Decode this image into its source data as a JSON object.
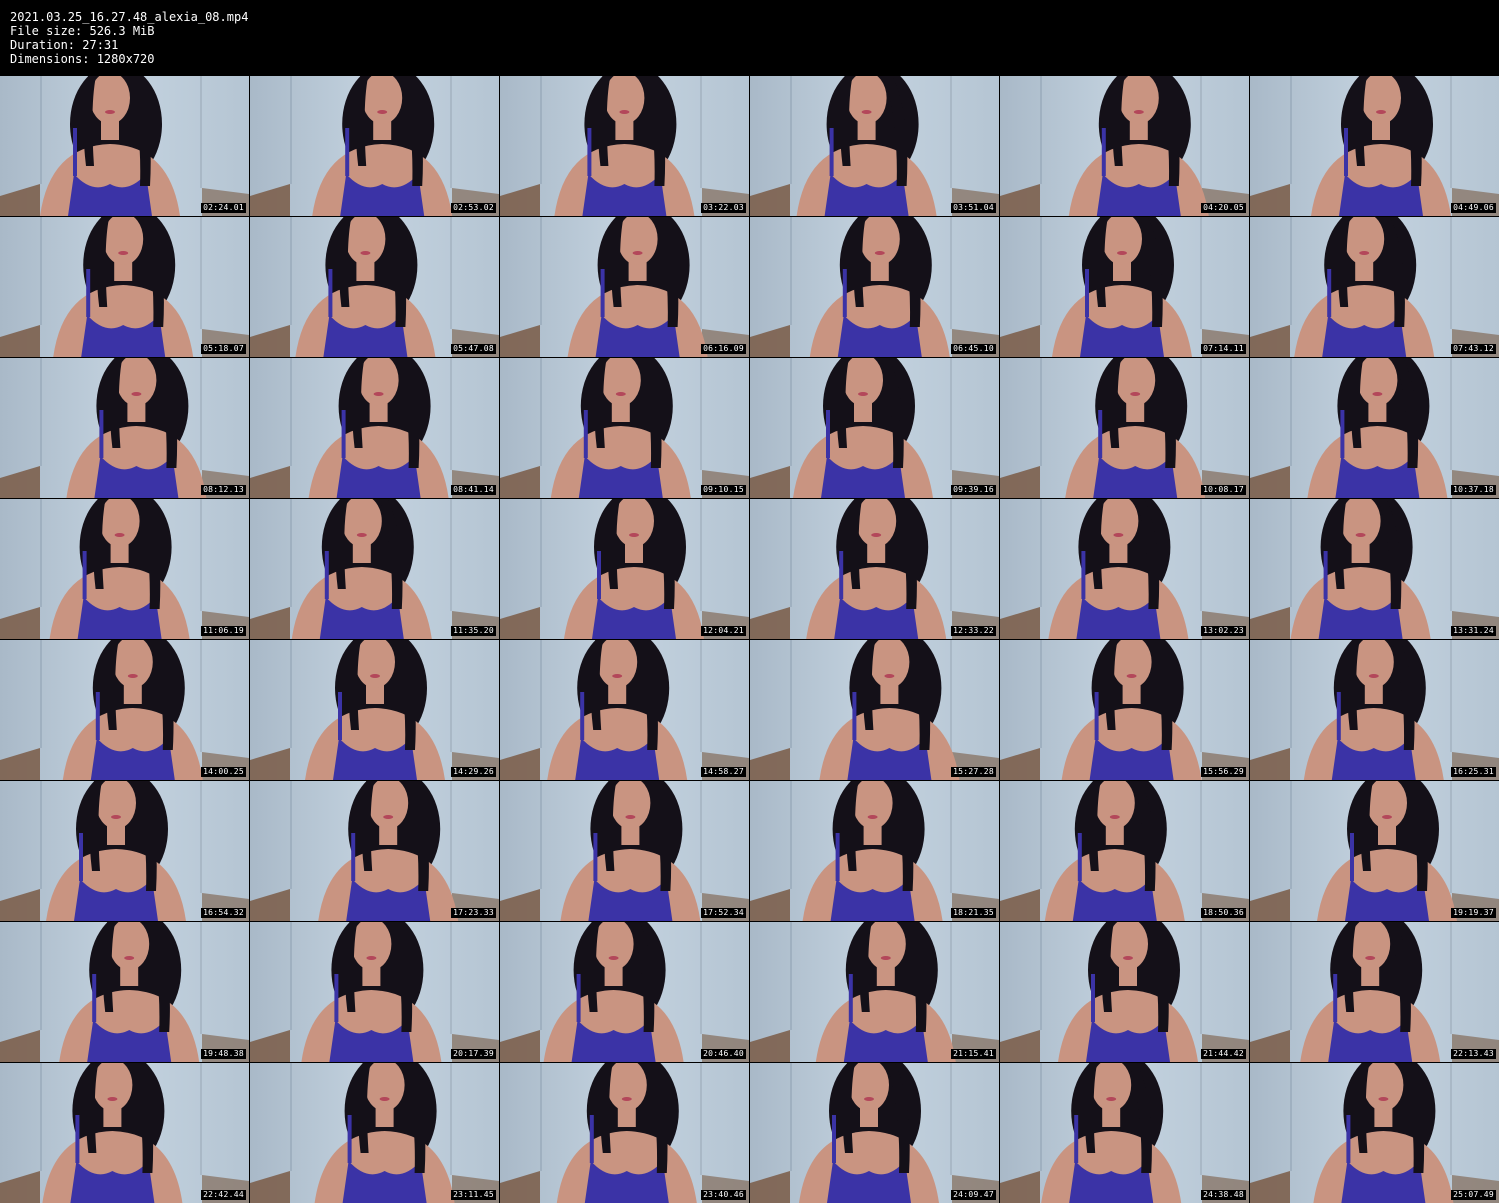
{
  "header": {
    "filename": "2021.03.25_16.27.48_alexia_08.mp4",
    "file_size": "File size: 526.3 MiB",
    "duration": "Duration: 27:31",
    "dimensions": "Dimensions: 1280x720"
  },
  "colors": {
    "background": "#000000",
    "text": "#ffffff",
    "wall": "#c3d2df",
    "floor": "#7a5b45",
    "dress": "#3b33a6",
    "hair": "#141018",
    "skin": "#c99481"
  },
  "thumbnails": [
    {
      "timestamp": "02:24.01"
    },
    {
      "timestamp": "02:53.02"
    },
    {
      "timestamp": "03:22.03"
    },
    {
      "timestamp": "03:51.04"
    },
    {
      "timestamp": "04:20.05"
    },
    {
      "timestamp": "04:49.06"
    },
    {
      "timestamp": "05:18.07"
    },
    {
      "timestamp": "05:47.08"
    },
    {
      "timestamp": "06:16.09"
    },
    {
      "timestamp": "06:45.10"
    },
    {
      "timestamp": "07:14.11"
    },
    {
      "timestamp": "07:43.12"
    },
    {
      "timestamp": "08:12.13"
    },
    {
      "timestamp": "08:41.14"
    },
    {
      "timestamp": "09:10.15"
    },
    {
      "timestamp": "09:39.16"
    },
    {
      "timestamp": "10:08.17"
    },
    {
      "timestamp": "10:37.18"
    },
    {
      "timestamp": "11:06.19"
    },
    {
      "timestamp": "11:35.20"
    },
    {
      "timestamp": "12:04.21"
    },
    {
      "timestamp": "12:33.22"
    },
    {
      "timestamp": "13:02.23"
    },
    {
      "timestamp": "13:31.24"
    },
    {
      "timestamp": "14:00.25"
    },
    {
      "timestamp": "14:29.26"
    },
    {
      "timestamp": "14:58.27"
    },
    {
      "timestamp": "15:27.28"
    },
    {
      "timestamp": "15:56.29"
    },
    {
      "timestamp": "16:25.31"
    },
    {
      "timestamp": "16:54.32"
    },
    {
      "timestamp": "17:23.33"
    },
    {
      "timestamp": "17:52.34"
    },
    {
      "timestamp": "18:21.35"
    },
    {
      "timestamp": "18:50.36"
    },
    {
      "timestamp": "19:19.37"
    },
    {
      "timestamp": "19:48.38"
    },
    {
      "timestamp": "20:17.39"
    },
    {
      "timestamp": "20:46.40"
    },
    {
      "timestamp": "21:15.41"
    },
    {
      "timestamp": "21:44.42"
    },
    {
      "timestamp": "22:13.43"
    },
    {
      "timestamp": "22:42.44"
    },
    {
      "timestamp": "23:11.45"
    },
    {
      "timestamp": "23:40.46"
    },
    {
      "timestamp": "24:09.47"
    },
    {
      "timestamp": "24:38.48"
    },
    {
      "timestamp": "25:07.49"
    }
  ]
}
